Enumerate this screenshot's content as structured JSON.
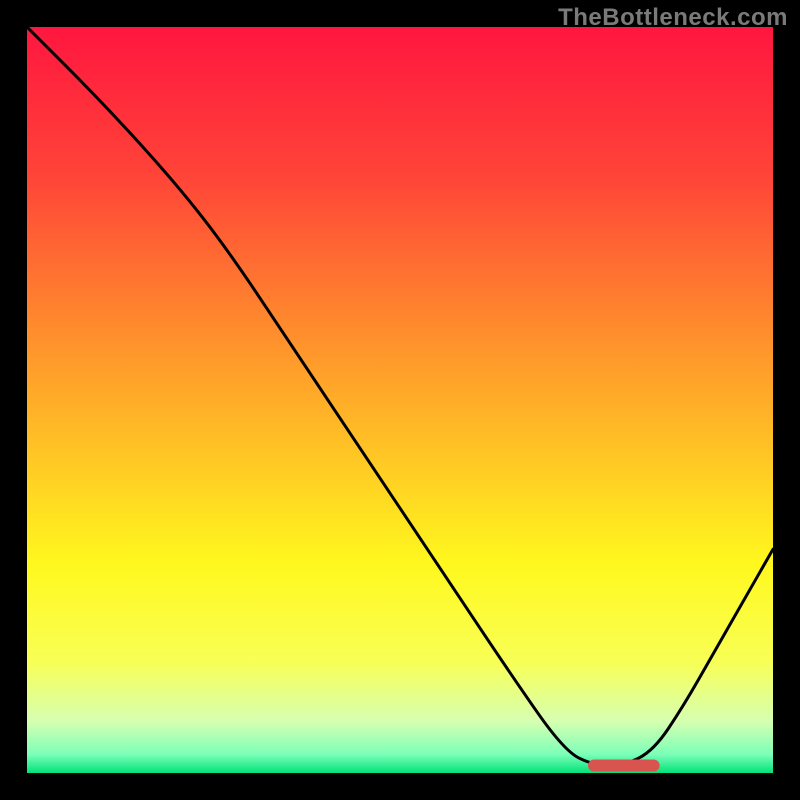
{
  "watermark": "TheBottleneck.com",
  "chart_data": {
    "type": "line",
    "title": "",
    "xlabel": "",
    "ylabel": "",
    "xlim": [
      0,
      100
    ],
    "ylim": [
      0,
      100
    ],
    "grid": false,
    "legend": false,
    "series": [
      {
        "name": "curve",
        "x": [
          0,
          10,
          20,
          27,
          35,
          45,
          55,
          65,
          72,
          76,
          80,
          84,
          88,
          92,
          96,
          100
        ],
        "y": [
          100,
          90,
          79,
          70,
          58,
          43,
          28,
          13,
          3,
          1,
          1,
          3,
          9,
          16,
          23,
          30
        ]
      }
    ],
    "marker": {
      "x_start": 76,
      "x_end": 84,
      "y": 1
    },
    "gradient_stops": [
      {
        "offset": 0.0,
        "color": "#ff163f"
      },
      {
        "offset": 0.2,
        "color": "#ff4438"
      },
      {
        "offset": 0.4,
        "color": "#ff8a2d"
      },
      {
        "offset": 0.58,
        "color": "#ffc824"
      },
      {
        "offset": 0.72,
        "color": "#fff81e"
      },
      {
        "offset": 0.85,
        "color": "#f8ff55"
      },
      {
        "offset": 0.93,
        "color": "#d7ffb0"
      },
      {
        "offset": 0.975,
        "color": "#7cffb8"
      },
      {
        "offset": 1.0,
        "color": "#00e27a"
      }
    ],
    "curve_stroke": "#000000",
    "curve_width": 3,
    "marker_color": "#d9544f",
    "marker_thickness": 12
  }
}
